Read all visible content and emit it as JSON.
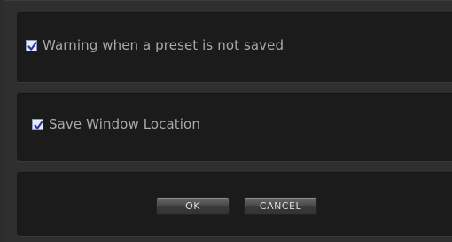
{
  "options": [
    {
      "label": "Warning when a preset is not saved",
      "checked": true
    },
    {
      "label": "Save Window Location",
      "checked": true
    }
  ],
  "buttons": {
    "ok": "OK",
    "cancel": "CANCEL"
  },
  "colors": {
    "checkmark": "#2b3aa5",
    "panel": "#1b1b1b",
    "background": "#2f2f2f",
    "label": "#a9a9a9"
  }
}
